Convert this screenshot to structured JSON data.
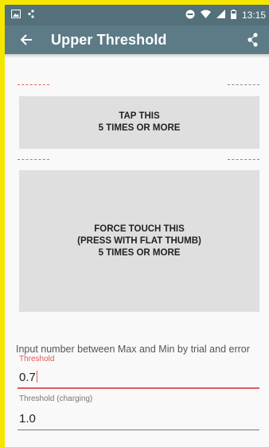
{
  "status_bar": {
    "time": "13:15",
    "left_icons": [
      "image-icon",
      "app-notification-icon"
    ],
    "right_icons": [
      "do-not-disturb-icon",
      "wifi-icon",
      "signal-icon",
      "battery-icon"
    ]
  },
  "app_bar": {
    "title": "Upper Threshold",
    "back_icon": "arrow-left-icon",
    "action_icon": "share-icon"
  },
  "tap_area": {
    "label": "TAP THIS\n5 TIMES OR MORE"
  },
  "force_area": {
    "label": "FORCE TOUCH THIS\n(PRESS WITH FLAT THUMB)\n5 TIMES OR MORE"
  },
  "hint": "Input number between Max and Min by trial and error",
  "fields": [
    {
      "label": "Threshold",
      "value": "0.7",
      "focused": true
    },
    {
      "label": "Threshold (charging)",
      "value": "1.0",
      "focused": false
    }
  ],
  "colors": {
    "status_bar": "#53707b",
    "app_bar": "#5d7b86",
    "accent": "#e25b5b",
    "frame": "#f5e600",
    "tap_area": "#dfdfdf"
  }
}
